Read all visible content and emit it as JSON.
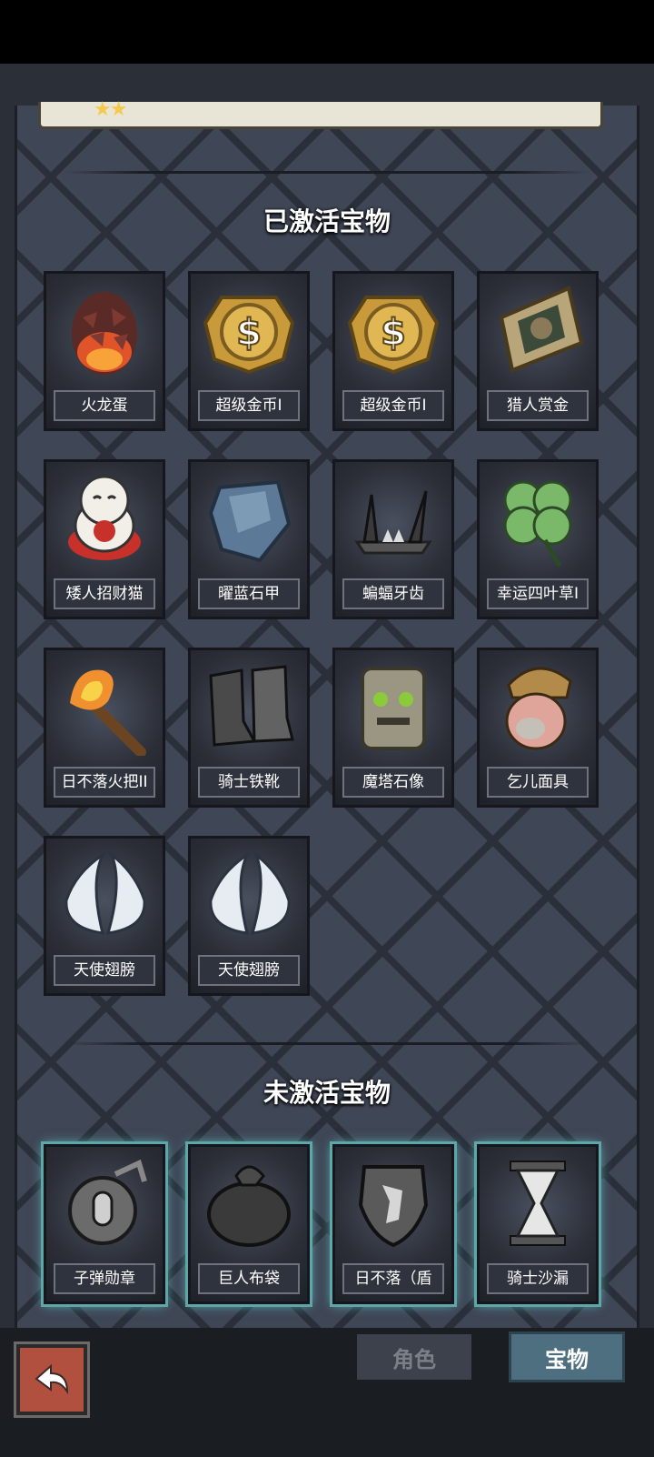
{
  "active_section": {
    "title": "已激活宝物"
  },
  "inactive_section": {
    "title": "未激活宝物"
  },
  "active_items": [
    {
      "label": "火龙蛋",
      "icon": "dragon-egg-icon"
    },
    {
      "label": "超级金币I",
      "icon": "gold-coin-icon"
    },
    {
      "label": "超级金币I",
      "icon": "gold-coin-icon"
    },
    {
      "label": "猎人赏金",
      "icon": "bounty-poster-icon"
    },
    {
      "label": "矮人招财猫",
      "icon": "lucky-cat-icon"
    },
    {
      "label": "曜蓝石甲",
      "icon": "blue-armor-icon"
    },
    {
      "label": "蝙蝠牙齿",
      "icon": "bat-fang-icon"
    },
    {
      "label": "幸运四叶草I",
      "icon": "four-leaf-clover-icon"
    },
    {
      "label": "日不落火把II",
      "icon": "torch-icon"
    },
    {
      "label": "骑士铁靴",
      "icon": "iron-boots-icon"
    },
    {
      "label": "魔塔石像",
      "icon": "stone-statue-icon"
    },
    {
      "label": "乞儿面具",
      "icon": "beggar-mask-icon"
    },
    {
      "label": "天使翅膀",
      "icon": "angel-wings-icon"
    },
    {
      "label": "天使翅膀",
      "icon": "angel-wings-icon"
    }
  ],
  "inactive_items": [
    {
      "label": "子弹勋章",
      "icon": "bullet-medal-icon"
    },
    {
      "label": "巨人布袋",
      "icon": "giant-sack-icon"
    },
    {
      "label": "日不落（盾",
      "icon": "shield-icon"
    },
    {
      "label": "骑士沙漏",
      "icon": "hourglass-icon"
    }
  ],
  "tabs": {
    "role": "角色",
    "treasure": "宝物"
  },
  "colors": {
    "panel": "#3f4656",
    "label_bg": "#2f333d",
    "inactive_glow": "#5fc9c6",
    "active_tab": "#4d6f7f"
  }
}
